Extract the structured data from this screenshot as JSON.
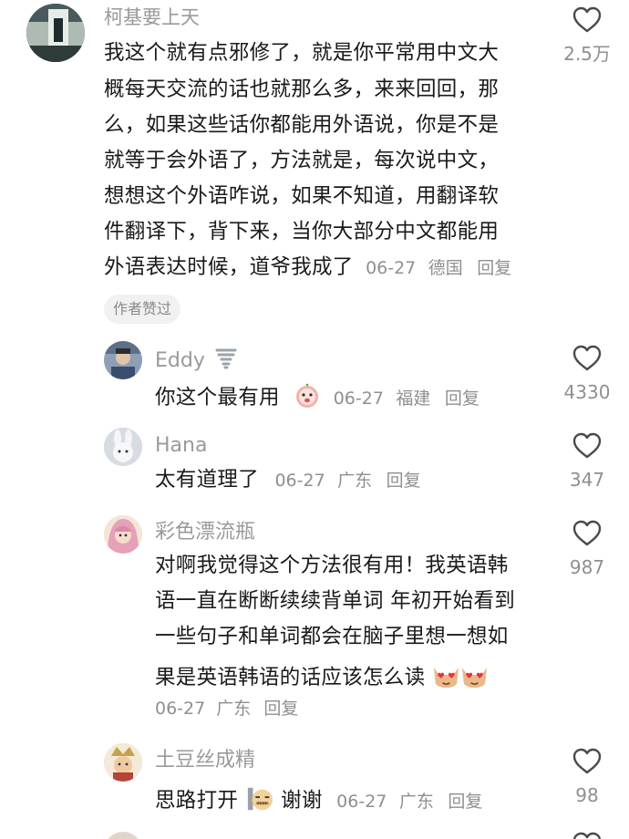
{
  "comments": [
    {
      "author": "柯基要上天",
      "lines": [
        "我这个就有点邪修了，就是你平常用中文大",
        "概每天交流的话也就那么多，来来回回，那",
        "么，如果这些话你都能用外语说，你是不是",
        "就等于会外语了，方法就是，每次说中文，",
        "想想这个外语咋说，如果不知道，用翻译软",
        "件翻译下，背下来，当你大部分中文都能用",
        "外语表达时候，道爷我成了"
      ],
      "date": "06-27",
      "location": "德国",
      "reply_label": "回复",
      "likes": "2.5万",
      "badge": "作者赞过"
    }
  ],
  "replies": [
    {
      "author": "Eddy",
      "author_icon": "tornado-icon",
      "text": "你这个最有用",
      "emoji": "peach-face-emoji",
      "date": "06-27",
      "location": "福建",
      "reply_label": "回复",
      "likes": "4330"
    },
    {
      "author": "Hana",
      "text": "太有道理了",
      "date": "06-27",
      "location": "广东",
      "reply_label": "回复",
      "likes": "347"
    },
    {
      "author": "彩色漂流瓶",
      "lines": [
        "对啊我觉得这个方法很有用！我英语韩",
        "语一直在断断续续背单词 年初开始看到",
        "一些句子和单词都会在脑子里想一想如",
        "果是英语韩语的话应该怎么读"
      ],
      "emoji": "heart-eyes-cat-emoji",
      "date": "06-27",
      "location": "广东",
      "reply_label": "回复",
      "likes": "987"
    },
    {
      "author": "土豆丝成精",
      "text_before": "思路打开",
      "text_after": "谢谢",
      "emoji": "zipper-face-emoji",
      "date": "06-27",
      "location": "广东",
      "reply_label": "回复",
      "likes": "98"
    }
  ],
  "colors": {
    "author": "#9a9a9a",
    "text": "#1a1a1a",
    "meta": "#8f8f8f",
    "badge_bg": "#f1f1f1"
  }
}
